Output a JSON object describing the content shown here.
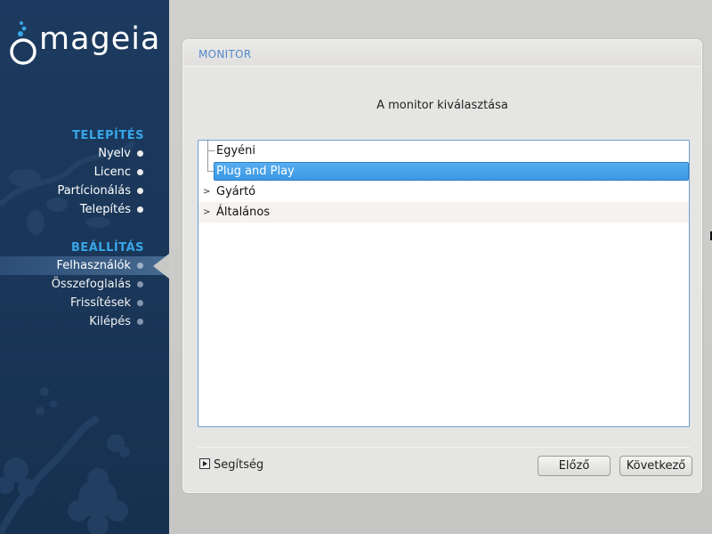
{
  "brand": {
    "logo_text": "mageia"
  },
  "sidebar": {
    "sections": [
      {
        "title": "TELEPÍTÉS",
        "items": [
          {
            "label": "Nyelv",
            "state": "done"
          },
          {
            "label": "Licenc",
            "state": "done"
          },
          {
            "label": "Partícionálás",
            "state": "done"
          },
          {
            "label": "Telepítés",
            "state": "done"
          }
        ]
      },
      {
        "title": "BEÁLLÍTÁS",
        "items": [
          {
            "label": "Felhasználók",
            "state": "active"
          },
          {
            "label": "Összefoglalás",
            "state": "todo"
          },
          {
            "label": "Frissítések",
            "state": "todo"
          },
          {
            "label": "Kilépés",
            "state": "todo"
          }
        ]
      }
    ]
  },
  "panel": {
    "title": "MONITOR",
    "subtitle": "A monitor kiválasztása",
    "tree": [
      {
        "label": "Egyéni",
        "expandable": false,
        "selected": false
      },
      {
        "label": "Plug and Play",
        "expandable": false,
        "selected": true
      },
      {
        "label": "Gyártó",
        "expandable": true,
        "selected": false
      },
      {
        "label": "Általános",
        "expandable": true,
        "selected": false
      }
    ]
  },
  "footer": {
    "help_label": "Segítség",
    "prev_label": "Előző",
    "next_label": "Következő"
  },
  "colors": {
    "sidebar_bg": "#1c3a5f",
    "section_title": "#38a6e8",
    "panel_title": "#5289cc",
    "selection": "#3c98e3"
  }
}
